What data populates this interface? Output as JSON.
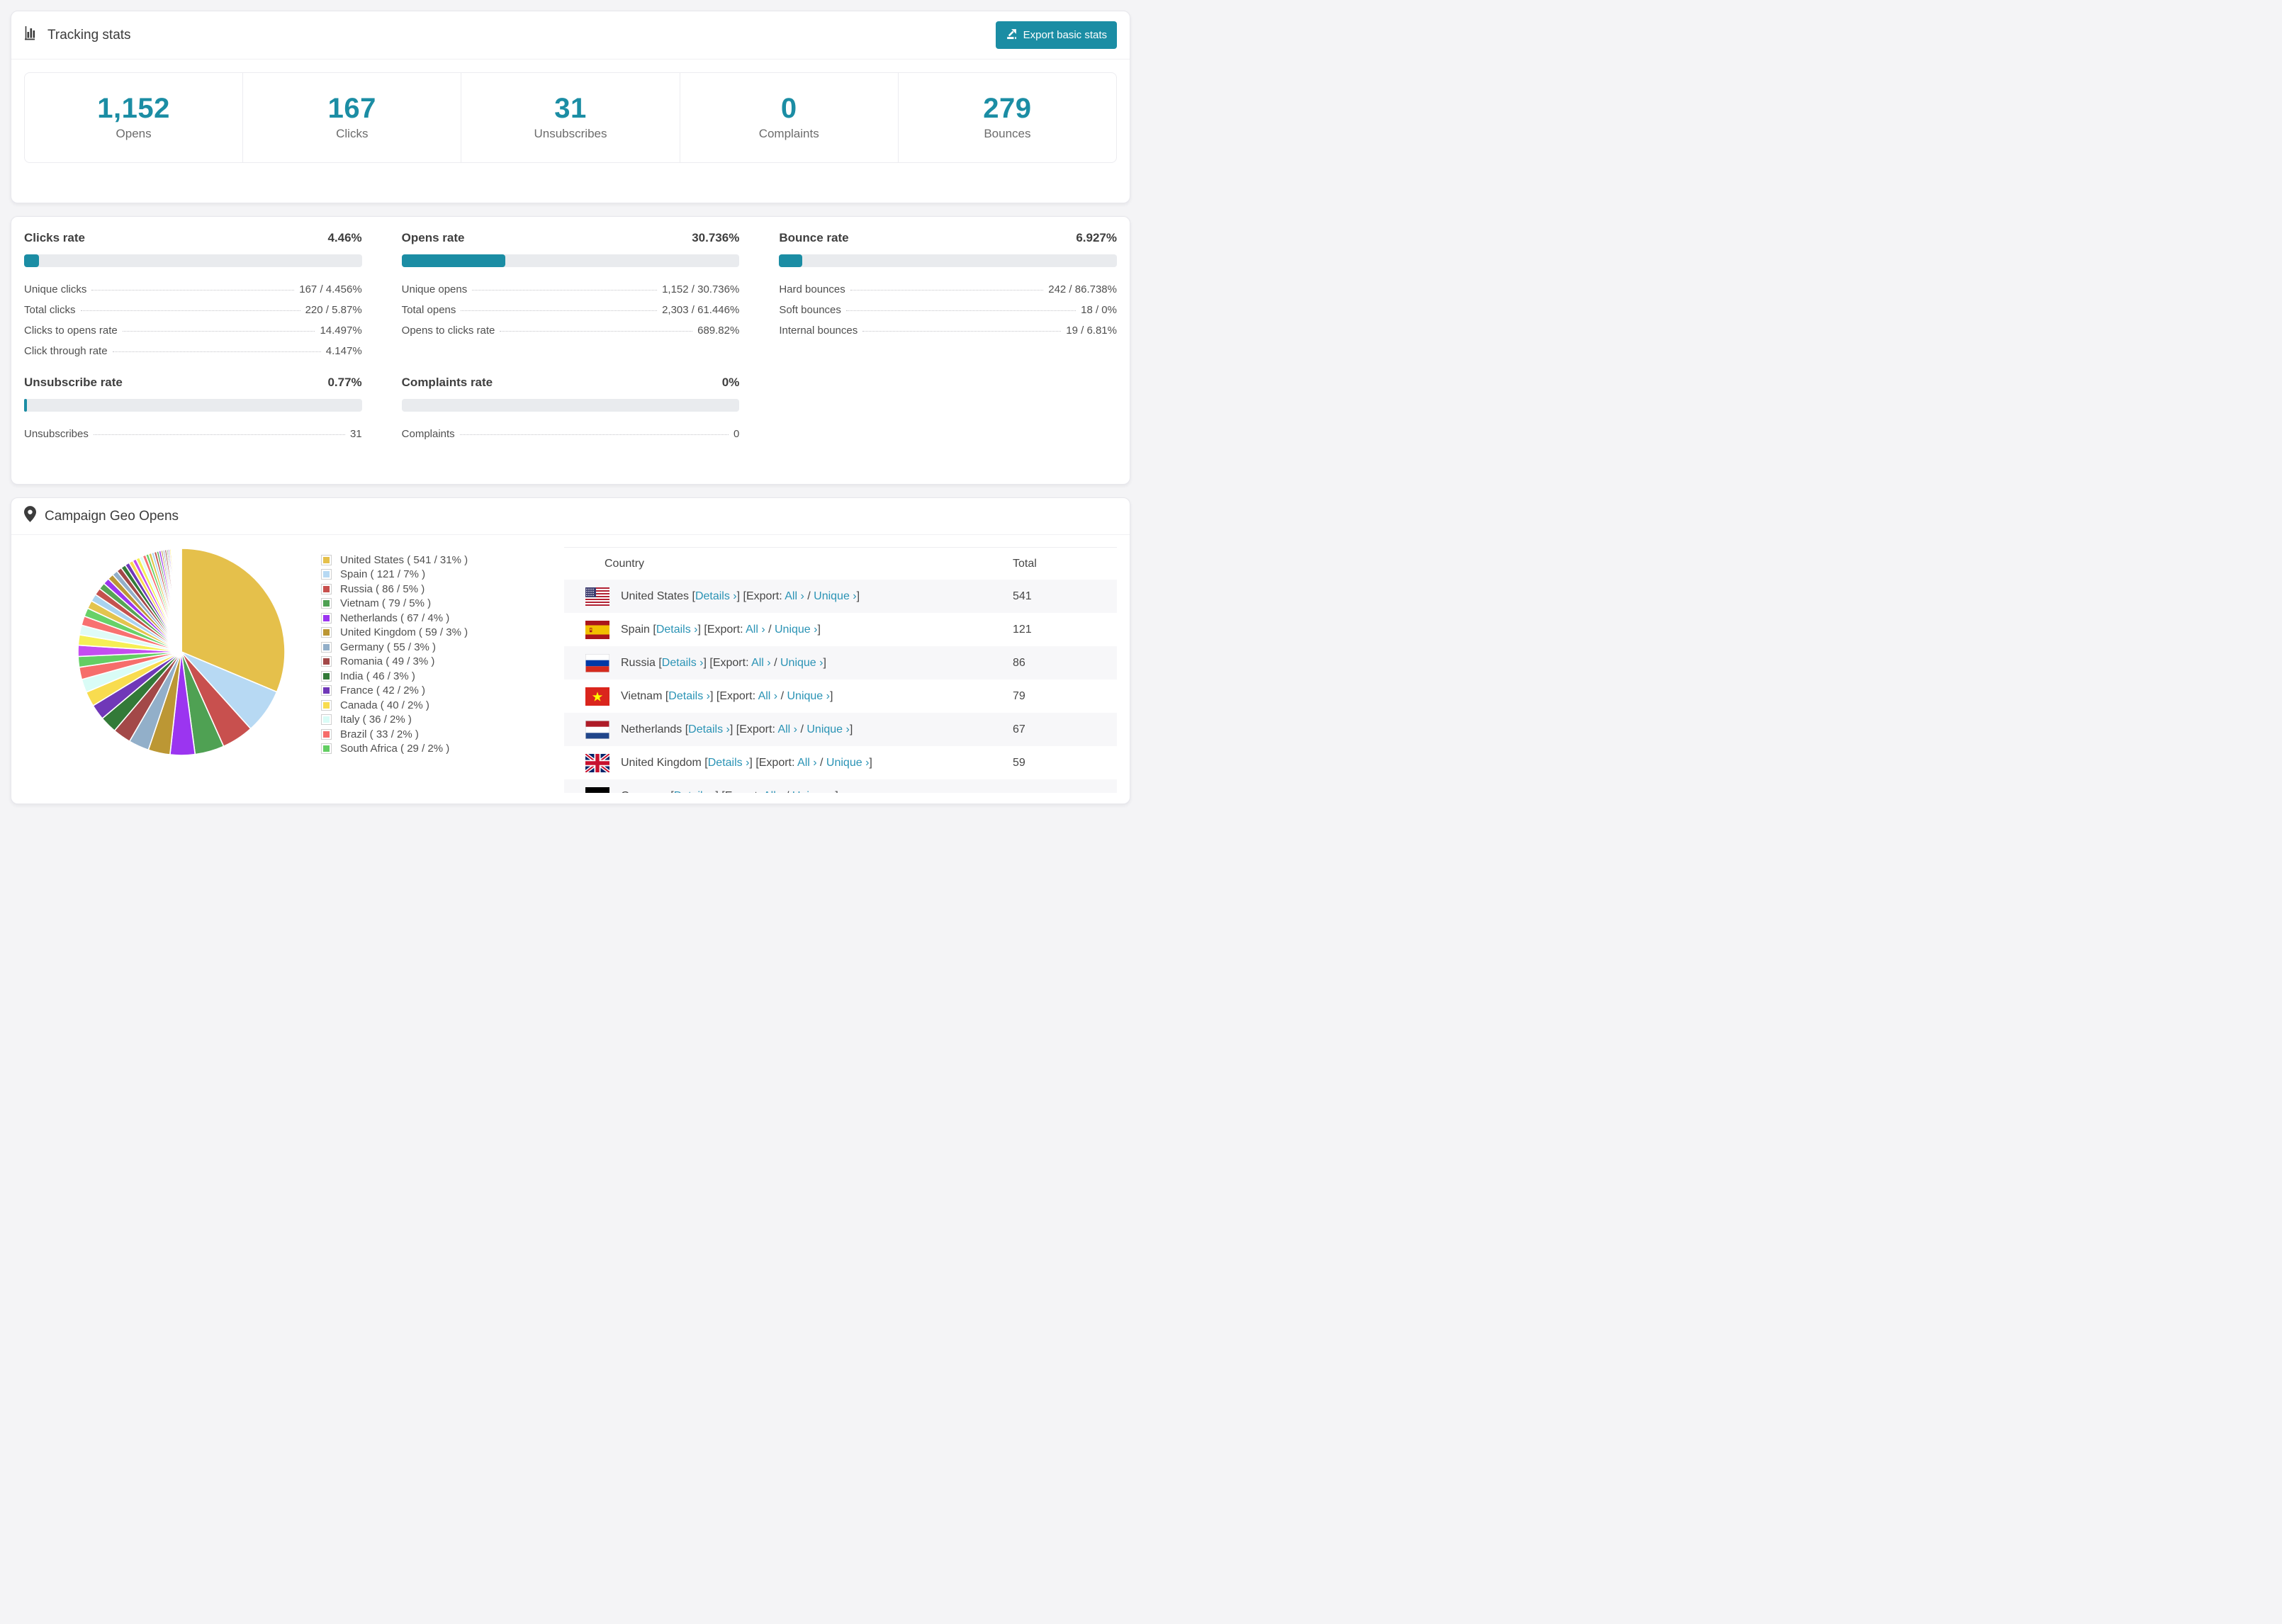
{
  "colors": {
    "accent": "#1b8da4",
    "link": "#2a93b5",
    "bar_track": "#e9ebee",
    "page_bg": "#f4f4f6"
  },
  "tracking": {
    "title": "Tracking stats",
    "export_button_label": "Export basic stats",
    "stats": [
      {
        "value": "1,152",
        "label": "Opens"
      },
      {
        "value": "167",
        "label": "Clicks"
      },
      {
        "value": "31",
        "label": "Unsubscribes"
      },
      {
        "value": "0",
        "label": "Complaints"
      },
      {
        "value": "279",
        "label": "Bounces"
      }
    ]
  },
  "rates": {
    "panels": [
      {
        "title": "Clicks rate",
        "percent": "4.46%",
        "bar": 4.46,
        "rows": [
          [
            "Unique clicks",
            "167 / 4.456%"
          ],
          [
            "Total clicks",
            "220 / 5.87%"
          ],
          [
            "Clicks to opens rate",
            "14.497%"
          ],
          [
            "Click through rate",
            "4.147%"
          ]
        ]
      },
      {
        "title": "Opens rate",
        "percent": "30.736%",
        "bar": 30.736,
        "rows": [
          [
            "Unique opens",
            "1,152 / 30.736%"
          ],
          [
            "Total opens",
            "2,303 / 61.446%"
          ],
          [
            "Opens to clicks rate",
            "689.82%"
          ]
        ]
      },
      {
        "title": "Bounce rate",
        "percent": "6.927%",
        "bar": 6.927,
        "rows": [
          [
            "Hard bounces",
            "242 / 86.738%"
          ],
          [
            "Soft bounces",
            "18 / 0%"
          ],
          [
            "Internal bounces",
            "19 / 6.81%"
          ]
        ]
      },
      {
        "title": "Unsubscribe rate",
        "percent": "0.77%",
        "bar": 0.77,
        "rows": [
          [
            "Unsubscribes",
            "31"
          ]
        ]
      },
      {
        "title": "Complaints rate",
        "percent": "0%",
        "bar": 0,
        "rows": [
          [
            "Complaints",
            "0"
          ]
        ]
      }
    ]
  },
  "geo": {
    "title": "Campaign Geo Opens",
    "table": {
      "headers": [
        "Country",
        "Total"
      ],
      "link_labels": {
        "details": "Details ›",
        "export": "Export:",
        "all": "All ›",
        "unique": "Unique ›"
      },
      "rows": [
        {
          "country": "United States",
          "flag": "us",
          "total": "541"
        },
        {
          "country": "Spain",
          "flag": "es",
          "total": "121"
        },
        {
          "country": "Russia",
          "flag": "ru",
          "total": "86"
        },
        {
          "country": "Vietnam",
          "flag": "vn",
          "total": "79"
        },
        {
          "country": "Netherlands",
          "flag": "nl",
          "total": "67"
        },
        {
          "country": "United Kingdom",
          "flag": "gb",
          "total": "59"
        },
        {
          "country": "Germany",
          "flag": "de",
          "total": ""
        }
      ]
    }
  },
  "chart_data": {
    "type": "pie",
    "title": "Campaign Geo Opens",
    "legend_position": "right",
    "series": [
      {
        "name": "United States",
        "value": 541,
        "label": "United States ( 541 / 31% )",
        "color": "#E5C04B"
      },
      {
        "name": "Spain",
        "value": 121,
        "label": "Spain ( 121 / 7% )",
        "color": "#B7D9F3"
      },
      {
        "name": "Russia",
        "value": 86,
        "label": "Russia ( 86 / 5% )",
        "color": "#C8504E"
      },
      {
        "name": "Vietnam",
        "value": 79,
        "label": "Vietnam ( 79 / 5% )",
        "color": "#4FA153"
      },
      {
        "name": "Netherlands",
        "value": 67,
        "label": "Netherlands ( 67 / 4% )",
        "color": "#9B35F0"
      },
      {
        "name": "United Kingdom",
        "value": 59,
        "label": "United Kingdom ( 59 / 3% )",
        "color": "#BC9734"
      },
      {
        "name": "Germany",
        "value": 55,
        "label": "Germany ( 55 / 3% )",
        "color": "#92AFC9"
      },
      {
        "name": "Romania",
        "value": 49,
        "label": "Romania ( 49 / 3% )",
        "color": "#A34848"
      },
      {
        "name": "India",
        "value": 46,
        "label": "India ( 46 / 3% )",
        "color": "#337A38"
      },
      {
        "name": "France",
        "value": 42,
        "label": "France ( 42 / 2% )",
        "color": "#7038B8"
      },
      {
        "name": "Canada",
        "value": 40,
        "label": "Canada ( 40 / 2% )",
        "color": "#F8DC4F"
      },
      {
        "name": "Italy",
        "value": 36,
        "label": "Italy ( 36 / 2% )",
        "color": "#D9FCF6"
      },
      {
        "name": "Brazil",
        "value": 33,
        "label": "Brazil ( 33 / 2% )",
        "color": "#F66D6B"
      },
      {
        "name": "South Africa",
        "value": 29,
        "label": "South Africa ( 29 / 2% )",
        "color": "#63CE63"
      }
    ],
    "others": {
      "values": [
        30,
        28,
        26,
        25,
        23,
        22,
        20,
        19,
        18,
        17,
        16,
        15,
        14,
        13,
        12,
        11,
        10,
        10,
        9,
        9,
        8,
        8,
        7,
        7,
        6,
        6,
        5,
        5,
        5,
        4,
        4,
        4,
        3,
        3,
        3,
        3,
        2,
        2,
        2,
        2,
        2,
        1,
        1,
        1,
        1,
        1,
        1
      ],
      "palette": [
        "#C44DF0",
        "#F5EF55",
        "#DFFBF7",
        "#F87171",
        "#68D168",
        "#E3C44E",
        "#A9D3F0",
        "#C4524E",
        "#56A556",
        "#9B35F0",
        "#BC9734",
        "#92AFC9",
        "#A34848",
        "#337A38",
        "#7038B8",
        "#F8DC4F"
      ]
    }
  }
}
